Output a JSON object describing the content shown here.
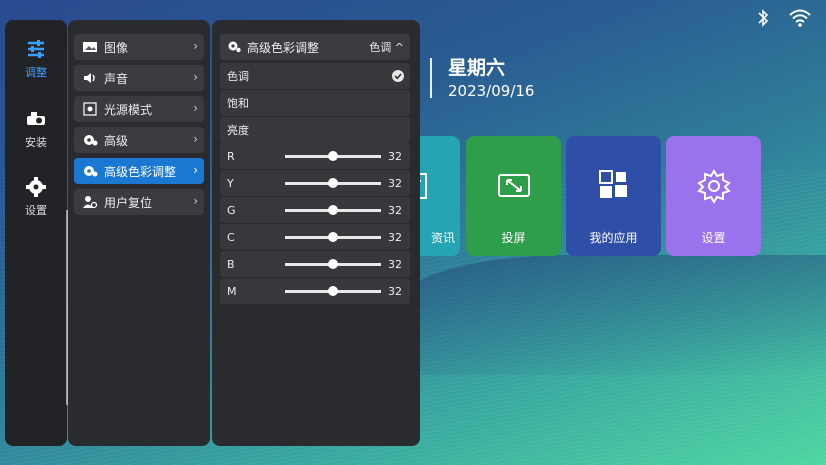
{
  "status": {
    "icons": [
      "bluetooth-icon",
      "wifi-icon"
    ]
  },
  "datetime": {
    "weekday": "星期六",
    "date": "2023/09/16"
  },
  "tiles": [
    {
      "label": "资讯",
      "color": "#25a5b4",
      "icon": "news-icon"
    },
    {
      "label": "投屏",
      "color": "#2e9e4b",
      "icon": "screen-cast-icon"
    },
    {
      "label": "我的应用",
      "color": "#2e4ea8",
      "icon": "apps-grid-icon"
    },
    {
      "label": "设置",
      "color": "#9a72ee",
      "icon": "gear-icon"
    }
  ],
  "sidebar": {
    "items": [
      {
        "label": "调整",
        "icon": "sliders-icon",
        "active": true
      },
      {
        "label": "安装",
        "icon": "projector-icon",
        "active": false
      },
      {
        "label": "设置",
        "icon": "gear-icon",
        "active": false
      }
    ]
  },
  "submenu": {
    "items": [
      {
        "label": "图像",
        "icon": "image-icon",
        "active": false
      },
      {
        "label": "声音",
        "icon": "speaker-icon",
        "active": false
      },
      {
        "label": "光源模式",
        "icon": "brightness-icon",
        "active": false
      },
      {
        "label": "高级",
        "icon": "advanced-gear-icon",
        "active": false
      },
      {
        "label": "高级色彩调整",
        "icon": "color-gear-icon",
        "active": true
      },
      {
        "label": "用户复位",
        "icon": "user-reset-icon",
        "active": false
      }
    ],
    "chevron": "›"
  },
  "color_panel": {
    "title": "高级色彩调整",
    "mode": "色调",
    "mode_arrow": "^",
    "options": [
      {
        "label": "色调",
        "checked": true
      },
      {
        "label": "饱和",
        "checked": false
      },
      {
        "label": "亮度",
        "checked": false
      }
    ],
    "sliders": [
      {
        "label": "R",
        "value": "32",
        "fraction": 0.5
      },
      {
        "label": "Y",
        "value": "32",
        "fraction": 0.5
      },
      {
        "label": "G",
        "value": "32",
        "fraction": 0.5
      },
      {
        "label": "C",
        "value": "32",
        "fraction": 0.5
      },
      {
        "label": "B",
        "value": "32",
        "fraction": 0.5
      },
      {
        "label": "M",
        "value": "32",
        "fraction": 0.5
      }
    ]
  },
  "colors": {
    "accent": "#1a78d2",
    "active_text": "#3aa0ff"
  }
}
